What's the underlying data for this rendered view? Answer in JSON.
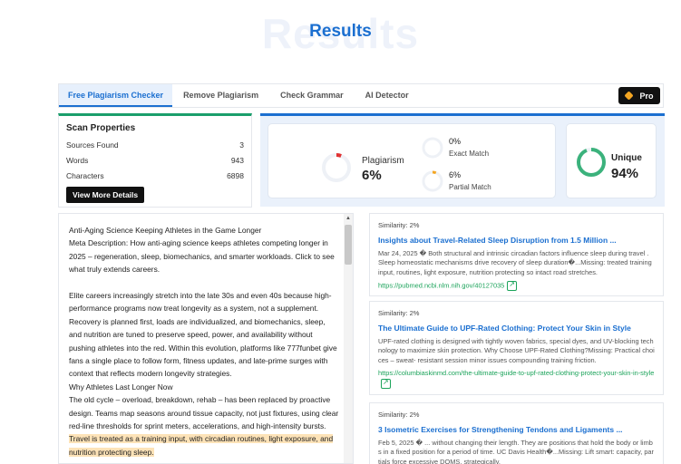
{
  "header": {
    "title": "Results",
    "watermark": "Results"
  },
  "tabs": [
    {
      "label": "Free Plagiarism Checker",
      "active": true
    },
    {
      "label": "Remove Plagiarism",
      "active": false
    },
    {
      "label": "Check Grammar",
      "active": false
    },
    {
      "label": "AI Detector",
      "active": false
    }
  ],
  "pro_button": {
    "label": "Pro",
    "icon": "diamond-icon"
  },
  "scan": {
    "title": "Scan Properties",
    "rows": [
      {
        "label": "Sources Found",
        "value": "3"
      },
      {
        "label": "Words",
        "value": "943"
      },
      {
        "label": "Characters",
        "value": "6898"
      }
    ],
    "button": "View More Details"
  },
  "stats": {
    "plagiarism": {
      "label": "Plagiarism",
      "value": "6%",
      "fraction": 0.06,
      "color": "#e03131"
    },
    "exact": {
      "value": "0%",
      "label": "Exact Match",
      "fraction": 0.0
    },
    "partial": {
      "value": "6%",
      "label": "Partial Match",
      "fraction": 0.06,
      "color": "#f4a623"
    },
    "unique": {
      "label": "Unique",
      "value": "94%",
      "fraction": 0.94,
      "color": "#3bb27c"
    }
  },
  "document": {
    "lines": [
      "Anti-Aging Science Keeping Athletes in the Game Longer",
      "Meta Description: How anti-aging science keeps athletes competing longer in 2025 – regeneration, sleep, biomechanics, and smarter workloads. Click to see what truly extends careers.",
      "",
      "Elite careers increasingly stretch into the late 30s and even 40s because high-performance programs now treat longevity as a system, not a supplement. Recovery is planned first, loads are individualized, and biomechanics, sleep, and nutrition are tuned to preserve speed, power, and availability without pushing athletes into the red. Within this evolution, platforms like 777funbet give fans a single place to follow form, fitness updates, and late-prime surges with context that reflects modern longevity strategies.",
      "Why Athletes Last Longer Now"
    ],
    "para_pre": "The old cycle – overload, breakdown, rehab – has been replaced by proactive design. Teams map seasons around tissue capacity, not just fixtures, using clear red-line thresholds for sprint meters, accelerations, and high-intensity bursts. ",
    "para_hl": "Travel is treated as a training input, with circadian routines, light exposure, and nutrition protecting sleep."
  },
  "results": [
    {
      "similarity": "Similarity: 2%",
      "title": "Insights about Travel-Related Sleep Disruption from 1.5 Million ...",
      "snippet": "Mar 24, 2025 � Both structural and intrinsic circadian factors influence sleep during travel . Sleep homeostatic mechanisms drive recovery of sleep duration�...Missing: treated training input, routines, light exposure, nutrition protecting so intact road stretches.",
      "url": "https://pubmed.ncbi.nlm.nih.gov/40127035"
    },
    {
      "similarity": "Similarity: 2%",
      "title": "The Ultimate Guide to UPF-Rated Clothing: Protect Your Skin in Style",
      "snippet": "UPF-rated clothing is designed with tightly woven fabrics, special dyes, and UV-blocking technology to maximize skin protection. Why Choose UPF-Rated Clothing?Missing: Practical choices – sweat- resistant session minor issues compounding training friction.",
      "url": "https://columbiaskinmd.com/the-ultimate-guide-to-upf-rated-clothing-protect-your-skin-in-style"
    },
    {
      "similarity": "Similarity: 2%",
      "title": "3 Isometric Exercises for Strengthening Tendons and Ligaments ...",
      "snippet": "Feb 5, 2025 � ... without changing their length. They are positions that hold the body or limbs in a fixed position for a period of time. UC Davis Health�...Missing: Lift smart: capacity, partials force excessive DOMS, strategically.",
      "url": ""
    }
  ]
}
